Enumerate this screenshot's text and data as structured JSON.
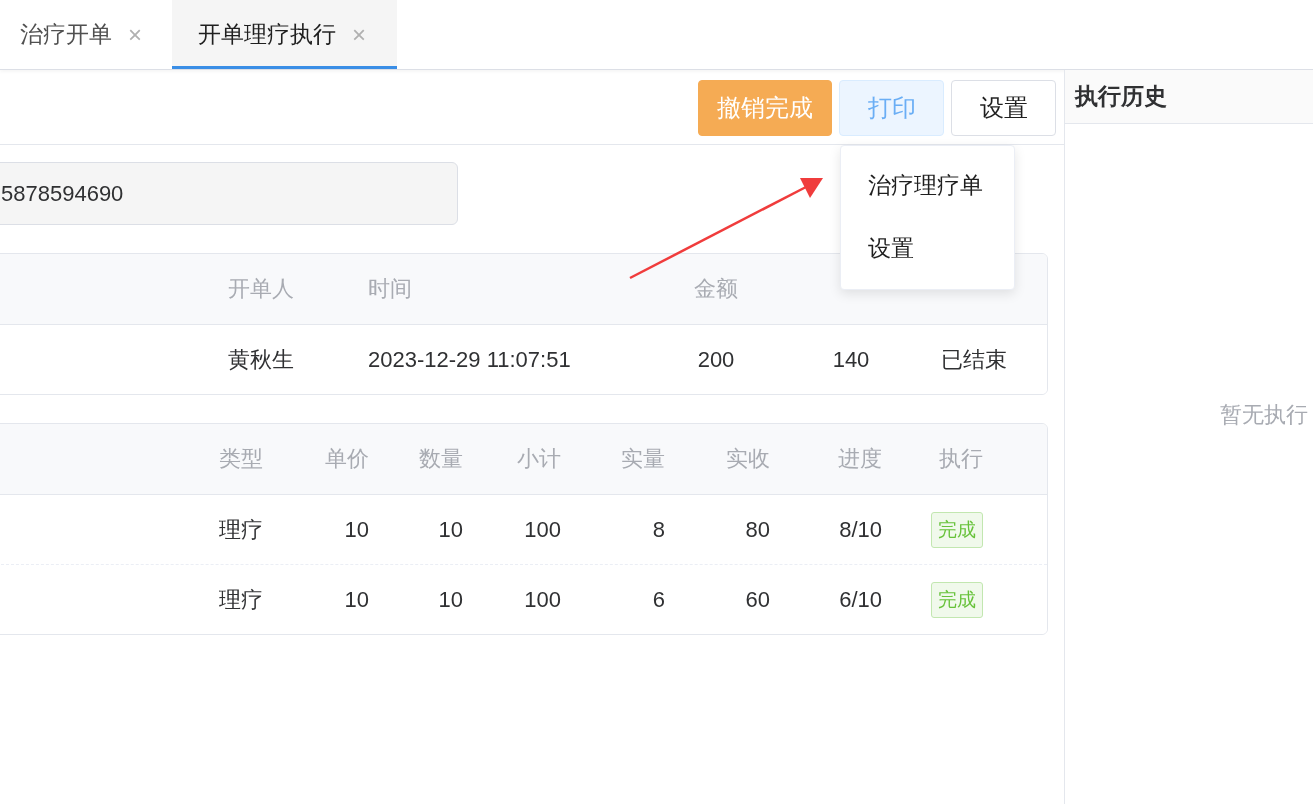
{
  "tabs": [
    {
      "label": "治疗开单",
      "close": "×",
      "selected": false
    },
    {
      "label": "开单理疗执行",
      "close": "×",
      "selected": true
    }
  ],
  "toolbar": {
    "buttons": [
      {
        "label": "撤销完成",
        "kind": "warning"
      },
      {
        "label": "打印",
        "kind": "plain-primary"
      },
      {
        "label": "设置",
        "kind": "default"
      }
    ]
  },
  "print_menu": {
    "items": [
      "治疗理疗单",
      "设置"
    ]
  },
  "search": {
    "value": "5878594690"
  },
  "order_table": {
    "columns": [
      "开单人",
      "时间",
      "金额"
    ],
    "rows": [
      [
        "黄秋生",
        "2023-12-29 11:07:51",
        "200",
        "140",
        "已结束"
      ]
    ]
  },
  "items_table": {
    "columns": [
      "类型",
      "单价",
      "数量",
      "小计",
      "实量",
      "实收",
      "进度",
      "执行"
    ],
    "rows": [
      {
        "cells": [
          "理疗",
          "10",
          "10",
          "100",
          "8",
          "80",
          "8/10"
        ],
        "action": "完成"
      },
      {
        "cells": [
          "理疗",
          "10",
          "10",
          "100",
          "6",
          "60",
          "6/10"
        ],
        "action": "完成"
      }
    ]
  },
  "history": {
    "title": "执行历史",
    "empty_text": "暂无执行"
  }
}
